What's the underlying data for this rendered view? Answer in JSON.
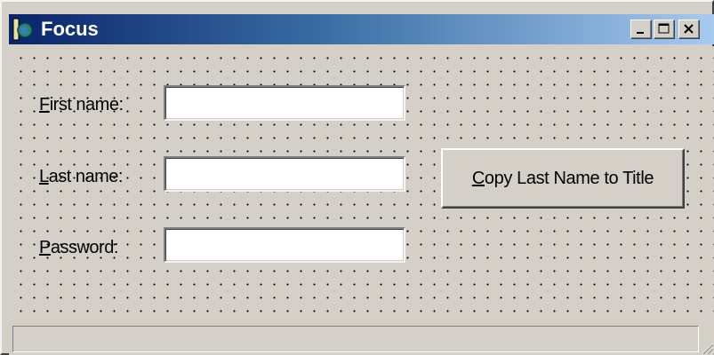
{
  "window": {
    "title": "Focus",
    "icon": "app-icon",
    "controls": [
      "minimize-icon",
      "maximize-icon",
      "close-icon"
    ]
  },
  "form": {
    "first_name": {
      "accel": "F",
      "rest": "irst name:",
      "value": ""
    },
    "last_name": {
      "accel": "L",
      "rest": "ast name:",
      "value": ""
    },
    "password": {
      "accel": "P",
      "rest": "assword:",
      "value": ""
    },
    "copy_button": {
      "accel": "C",
      "rest": "opy Last Name to Title"
    }
  },
  "statusbar": {
    "text": ""
  },
  "colors": {
    "face": "#d4d0c8",
    "title_start": "#0a246a",
    "title_end": "#a6caf0"
  }
}
